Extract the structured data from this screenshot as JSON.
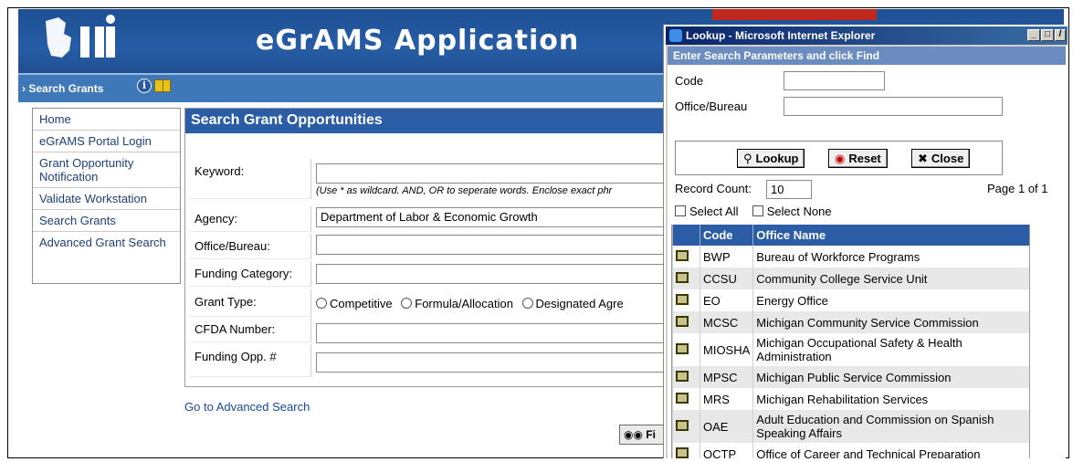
{
  "app": {
    "title": "eGrAMS Application",
    "section_title": "Search Grants"
  },
  "sidebar": {
    "items": [
      {
        "label": "Home"
      },
      {
        "label": "eGrAMS Portal Login"
      },
      {
        "label": "Grant Opportunity Notification"
      },
      {
        "label": "Validate Workstation"
      },
      {
        "label": "Search Grants"
      },
      {
        "label": "Advanced Grant Search"
      }
    ]
  },
  "main": {
    "title": "Search Grant Opportunities",
    "keyword_label": "Keyword:",
    "keyword_value": "",
    "keyword_hint": "(Use * as wildcard. AND, OR to seperate words. Enclose exact phr",
    "agency_label": "Agency:",
    "agency_value": "Department of Labor & Economic Growth",
    "office_label": "Office/Bureau:",
    "office_value": "",
    "funding_category_label": "Funding Category:",
    "funding_category_value": "",
    "grant_type_label": "Grant Type:",
    "grant_type_options": [
      "Competitive",
      "Formula/Allocation",
      "Designated Agre"
    ],
    "cfda_label": "CFDA Number:",
    "cfda_value": "",
    "funding_opp_label": "Funding Opp. #",
    "funding_opp_value": "",
    "advanced_link": "Go to Advanced Search",
    "find_button": "Fi"
  },
  "popup": {
    "window_title": "Lookup - Microsoft Internet Explorer",
    "instruction": "Enter Search Parameters and click Find",
    "code_label": "Code",
    "code_value": "",
    "office_label": "Office/Bureau",
    "office_value": "",
    "lookup_button": "Lookup",
    "reset_button": "Reset",
    "close_button": "Close",
    "record_count_label": "Record Count:",
    "record_count_value": "10",
    "page_info": "Page 1 of 1",
    "select_all_label": "Select All",
    "select_none_label": "Select None",
    "table": {
      "headers": [
        "Code",
        "Office Name"
      ],
      "rows": [
        {
          "code": "BWP",
          "name": "Bureau of Workforce Programs"
        },
        {
          "code": "CCSU",
          "name": "Community College Service Unit"
        },
        {
          "code": "EO",
          "name": "Energy Office"
        },
        {
          "code": "MCSC",
          "name": "Michigan Community Service Commission"
        },
        {
          "code": "MIOSHA",
          "name": "Michigan Occupational Safety & Health Administration"
        },
        {
          "code": "MPSC",
          "name": "Michigan Public Service Commission"
        },
        {
          "code": "MRS",
          "name": "Michigan Rehabilitation Services"
        },
        {
          "code": "OAE",
          "name": "Adult Education and Commission on Spanish Speaking Affairs"
        },
        {
          "code": "OCTP",
          "name": "Office of Career and Technical Preparation"
        }
      ]
    }
  },
  "colors": {
    "header_blue": "#275da6",
    "title_bar": "#0a246a",
    "link": "#1c4aa0"
  }
}
